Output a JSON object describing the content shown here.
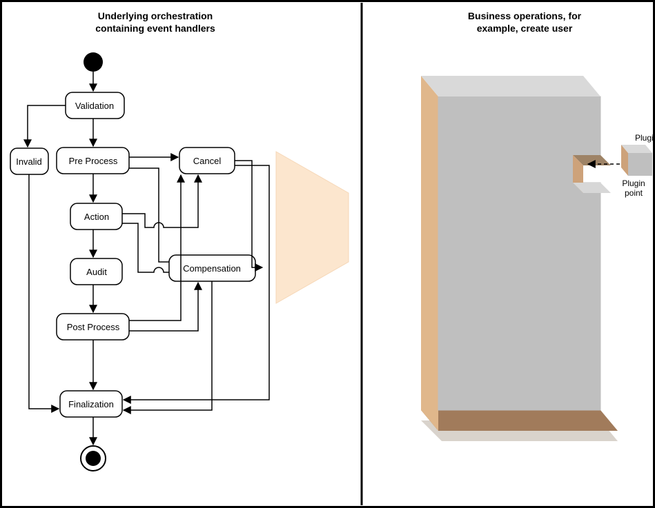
{
  "left": {
    "title_l1": "Underlying orchestration",
    "title_l2": "containing event handlers",
    "nodes": {
      "validation": "Validation",
      "invalid": "Invalid",
      "preprocess": "Pre Process",
      "action": "Action",
      "audit": "Audit",
      "postprocess": "Post Process",
      "finalization": "Finalization",
      "cancel": "Cancel",
      "compensation": "Compensation"
    }
  },
  "right": {
    "title_l1": "Business operations, for",
    "title_l2": "example, create user",
    "plugin": "Plugin",
    "plugin_point_l1": "Plugin",
    "plugin_point_l2": "point"
  },
  "chart_data": {
    "type": "flow-diagram",
    "left_flow": {
      "start": "start",
      "end": "end",
      "nodes": [
        "Validation",
        "Invalid",
        "Pre Process",
        "Action",
        "Audit",
        "Post Process",
        "Finalization",
        "Cancel",
        "Compensation"
      ],
      "edges": [
        [
          "start",
          "Validation"
        ],
        [
          "Validation",
          "Pre Process"
        ],
        [
          "Validation",
          "Invalid"
        ],
        [
          "Invalid",
          "Finalization"
        ],
        [
          "Pre Process",
          "Action"
        ],
        [
          "Pre Process",
          "Cancel"
        ],
        [
          "Pre Process",
          "Compensation"
        ],
        [
          "Action",
          "Audit"
        ],
        [
          "Action",
          "Cancel"
        ],
        [
          "Action",
          "Compensation"
        ],
        [
          "Audit",
          "Post Process"
        ],
        [
          "Post Process",
          "Finalization"
        ],
        [
          "Post Process",
          "Cancel"
        ],
        [
          "Post Process",
          "Compensation"
        ],
        [
          "Cancel",
          "Finalization"
        ],
        [
          "Cancel",
          "Compensation"
        ],
        [
          "Compensation",
          "Finalization"
        ],
        [
          "Finalization",
          "end"
        ]
      ]
    },
    "right_block": {
      "concept": "3D business-operations block with plugin notch",
      "labels": [
        "Plugin",
        "Plugin point"
      ],
      "plugin_arrow": "dashed, pointing into notch"
    }
  }
}
